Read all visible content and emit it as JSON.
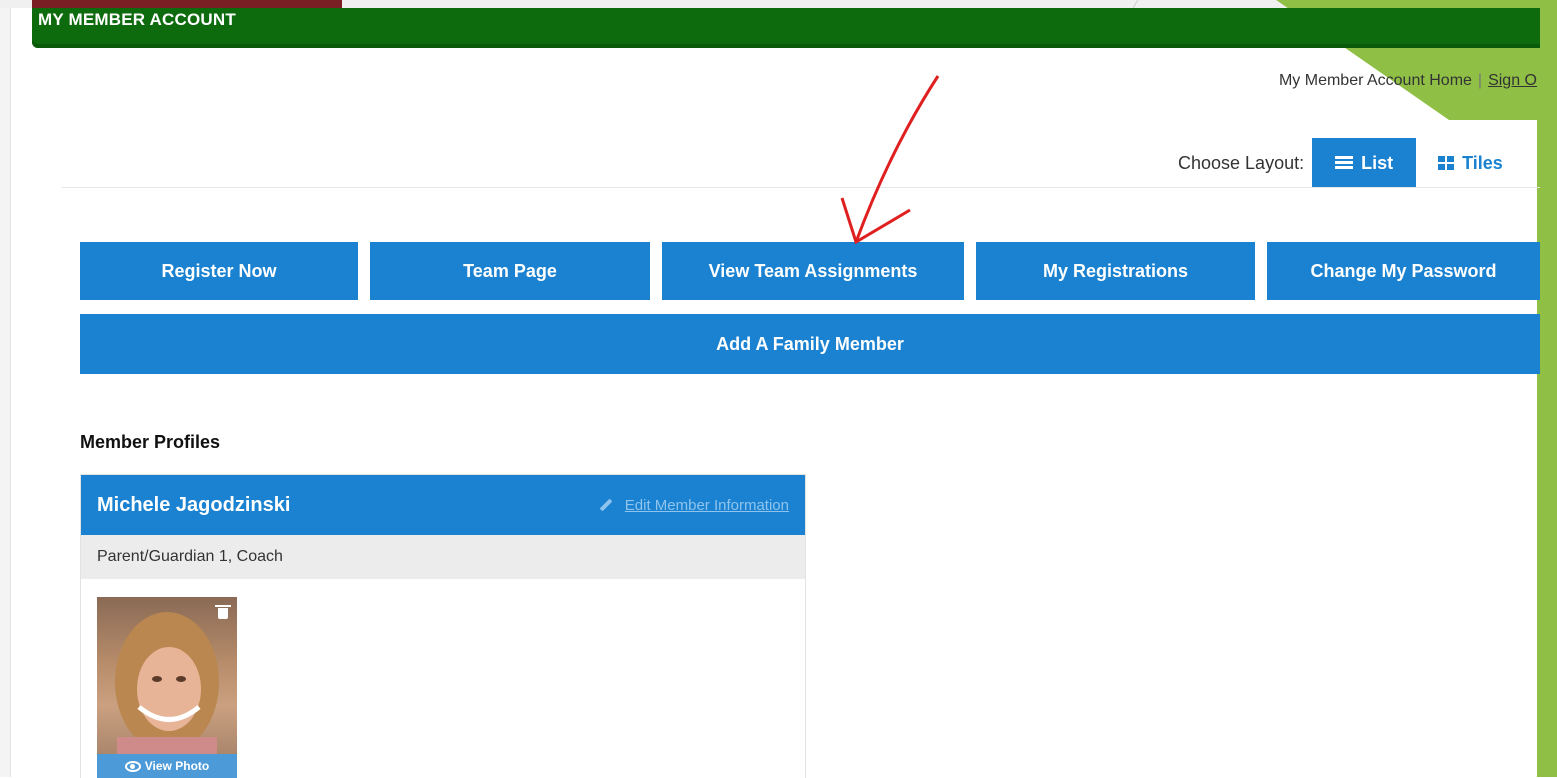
{
  "header": {
    "title": "MY MEMBER ACCOUNT"
  },
  "top_links": {
    "home": "My Member Account Home",
    "separator": "|",
    "sign_out": "Sign O"
  },
  "layout": {
    "label": "Choose Layout:",
    "list": "List",
    "tiles": "Tiles",
    "selected": "List"
  },
  "actions": {
    "register_now": "Register Now",
    "team_page": "Team Page",
    "view_team_assignments": "View Team Assignments",
    "my_registrations": "My Registrations",
    "change_password": "Change My Password",
    "add_family_member": "Add A Family Member"
  },
  "profiles": {
    "section_title": "Member Profiles",
    "members": [
      {
        "name": "Michele Jagodzinski",
        "edit_label": "Edit Member Information",
        "role": "Parent/Guardian 1, Coach",
        "view_photo": "View Photo"
      }
    ]
  },
  "colors": {
    "header_green": "#0d6b0d",
    "action_blue": "#1a82d0",
    "accent_lime": "#8fc045",
    "annotation_red": "#e02020"
  }
}
